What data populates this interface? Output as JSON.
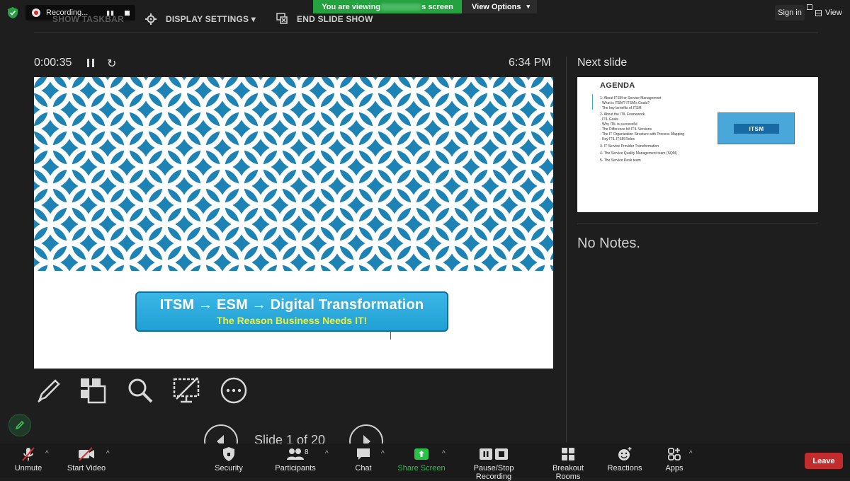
{
  "top_bar": {
    "recording_label": "Recording...",
    "recording_pause_label": "▮▮",
    "show_taskbar": "SHOW TASKBAR",
    "display_settings": "DISPLAY SETTINGS ▾",
    "end_slide_show": "END SLIDE SHOW",
    "viewing_prefix": "You are viewing",
    "viewing_suffix": "s screen",
    "view_options": "View Options",
    "sign_in": "Sign in",
    "view": "View"
  },
  "presenter": {
    "timer": "0:00:35",
    "reset_icon": "↻",
    "clock": "6:34 PM",
    "next_slide_header": "Next slide",
    "notes": "No Notes.",
    "slide_counter": "Slide 1 of 20"
  },
  "current_slide": {
    "title": "ITSM → ESM → Digital Transformation",
    "subtitle": "The Reason Business Needs IT!",
    "pattern_color": "#1d83b4"
  },
  "next_slide": {
    "title": "AGENDA",
    "items": [
      "1- About ITSM or Service Management",
      "· What is ITSM? ITSM's Goals?",
      "· The key benefits of ITSM",
      "2- About the ITIL Framework",
      "· ITIL Goals",
      "· Why ITIL is successful",
      "· The Difference b/t ITIL Versions",
      "· The IT Organization Structure with Process Mapping",
      "· Key ITIL ITSM Roles",
      "3- IT Service Provider Transformation",
      "4- The Service Quality Management team (SQM)",
      "5- The Service Desk team"
    ],
    "image_label": "ITSM"
  },
  "tools": [
    "pen-icon",
    "slides-grid-icon",
    "zoom-icon",
    "black-screen-icon",
    "more-options-icon"
  ],
  "toolbar": {
    "unmute": "Unmute",
    "start_video": "Start Video",
    "security": "Security",
    "participants": "Participants",
    "participants_count": "8",
    "chat": "Chat",
    "share_screen": "Share Screen",
    "pause_stop_recording": "Pause/Stop Recording",
    "breakout_rooms": "Breakout Rooms",
    "reactions": "Reactions",
    "apps": "Apps",
    "leave": "Leave"
  },
  "colors": {
    "background": "#1e1e1e",
    "viewing_banner": "#23a23f",
    "share_green": "#27c246",
    "leave_red": "#c22c2c",
    "slide_blue": "#1d83b4",
    "subtitle_yellow": "#f7ee2a"
  }
}
